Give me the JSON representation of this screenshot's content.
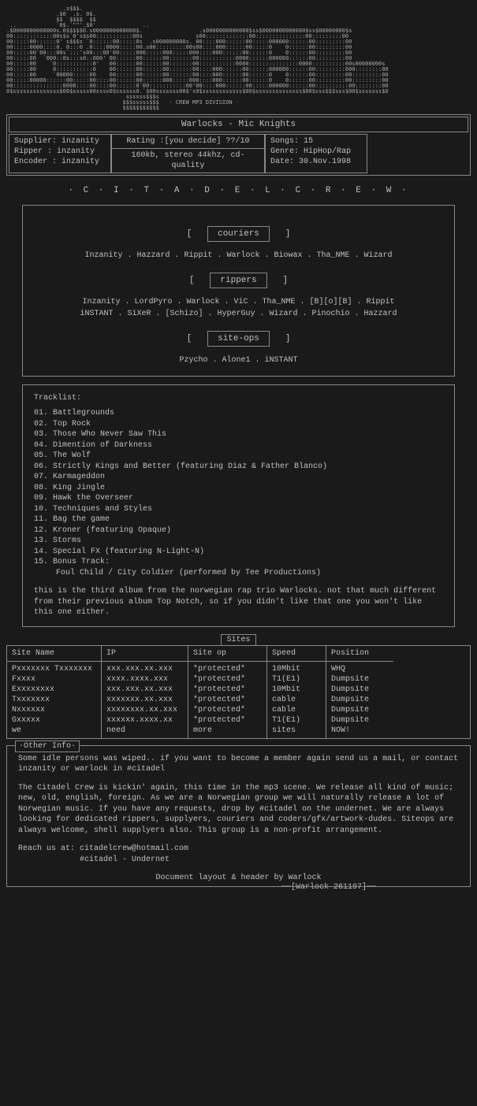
{
  "logo_ascii": "                 .s$$$.\n               .$0  .s. 0$.\n               $$  $$$$  $$\n ..            `0$.`\"\"'.$0'              ..\n.$0000000000000s.0$$$$$0.s0000000000000$.                 .s0000000000000$ss$0000000000000$ss$00000000$s\n00::::::::::::00s$s`0's$s00:::::::::::00s                s00:::::::::::::00:::::::::::::::00:::::::::00\n00:::::00::::::0' s$$$s `0::::::00:::::0s  .s000000000s. 00::::000::::::00:::::000000::::::00:::::::::00\n00:::::0000::::0. 0:::0 .0::::0000:::::00.s00:::::::::00s00::::000::::::00:::::0    0::::::00:::::::::00\n00:::::00`00:::00s`:::'s00:::00'00:::::000:::::000:::::000::::000::::::00::::::0    0::::::00:::::::::00\n00:::::00  `000::0s:::s0::000' 00::::::00::::::00:::::::00:::::::::::0000::::::000000::::::00:::::::::00\n00:::::00    `0:::::::::::0'   00::::::00::::::00:::::::00:::::::::::0000:::::::::::::::0000::::::::::00s00000000s\n00:::::00     0:::::::::::0    00::::::00::::::00:::::::00::::000::::::00::::::000000::::::00:::::::::000::::::::00\n00:::::00     `00000:::::00    00::::::00::::::00:::::::00::::000::::::00::::::0    0::::::00:::::::::00:::::::::00\n00:::::00000::::::00:::::00::::00::::::00::::::000:::::000::::000::::::00::::::0    0::::::00:::::::::00:::::::::00\n00:::::::::::::::0000::::00::::00::::::0`00:::::::::::00'00::::000::::::00:::::000000::::::00::::::::::00::::::::00\n0$ssssssssssssss$00$sssss00ssss0$ssssss0.`$00sssssss00$'s0$ssssssssssss$00$ssssssssssssss$00$sss$$$sss$00$sssssss$0\n                                    ssssss$$$s\n                                   $$$sssss$$$   · CREW MP3 DIVISION ·\n                                   $$$$$$$$$$$",
  "division": "· CREW MP3 DIVISION ·",
  "release": {
    "title": "Warlocks - Mic Knights",
    "supplier_label": "Supplier:",
    "supplier": "inzanity",
    "ripper_label": "Ripper  :",
    "ripper": "inzanity",
    "encoder_label": "Encoder :",
    "encoder": "inzanity",
    "rating_label": "Rating  :",
    "rating": "[you decide] ??/10",
    "quality": "160kb, stereo 44khz, cd-quality",
    "songs_label": "Songs:",
    "songs": "15",
    "genre_label": "Genre:",
    "genre": "HipHop/Rap",
    "date_label": "Date:",
    "date": "30.Nov.1998"
  },
  "crew_header": "· C · I · T · A · D · E · L · C · R · E · W ·",
  "roles": {
    "couriers_label": "couriers",
    "couriers": "Inzanity . Hazzard . Rippit . Warlock . Biowax . Tha_NME . Wizard",
    "rippers_label": "rippers",
    "rippers_line1": "Inzanity . LordPyro . Warlock . ViC . Tha_NME . [B][o][B] . Rippit",
    "rippers_line2": "iNSTANT . SiXeR . [Schizo] . HyperGuy . Wizard . Pinochio . Hazzard",
    "siteops_label": "site-ops",
    "siteops": "Pzycho . Alone1 . iNSTANT"
  },
  "tracklist": {
    "title": "Tracklist:",
    "tracks": [
      "01. Battlegrounds",
      "02. Top Rock",
      "03. Those Who Never Saw This",
      "04. Dimention of Darkness",
      "05. The Wolf",
      "06. Strictly Kings and Better (featuring Diaz & Father Blanco)",
      "07. Karmageddon",
      "08. King Jingle",
      "09. Hawk the Overseer",
      "10. Techniques and Styles",
      "11. Bag the game",
      "12. Kroner (featuring Opaque)",
      "13. Storms",
      "14. Special FX (featuring N-Light-N)",
      "15. Bonus Track:"
    ],
    "bonus_detail": "Foul Child / City Coldier (performed by Tee Productions)",
    "note": "this is the third album from the norwegian rap trio Warlocks. not that much different from their previous album Top Notch, so if you didn't like that one you won't like this one either."
  },
  "sites": {
    "header": "Sites",
    "col_headers": [
      "Site Name",
      "IP",
      "Site op",
      "Speed",
      "Position"
    ],
    "rows": [
      {
        "name": "Pxxxxxxx Txxxxxxx",
        "ip": "xxx.xxx.xx.xxx",
        "op": "*protected*",
        "speed": "10Mbit",
        "pos": "WHQ"
      },
      {
        "name": "Fxxxx",
        "ip": "xxxx.xxxx.xxx",
        "op": "*protected*",
        "speed": "T1(E1)",
        "pos": "Dumpsite"
      },
      {
        "name": "Exxxxxxxx",
        "ip": "xxx.xxx.xx.xxx",
        "op": "*protected*",
        "speed": "10Mbit",
        "pos": "Dumpsite"
      },
      {
        "name": "Txxxxxxx",
        "ip": "xxxxxxx.xx.xxx",
        "op": "*protected*",
        "speed": "cable",
        "pos": "Dumpsite"
      },
      {
        "name": "Nxxxxxx",
        "ip": "xxxxxxxx.xx.xxx",
        "op": "*protected*",
        "speed": "cable",
        "pos": "Dumpsite"
      },
      {
        "name": "Gxxxxx",
        "ip": "xxxxxx.xxxx.xx",
        "op": "*protected*",
        "speed": "T1(E1)",
        "pos": "Dumpsite"
      },
      {
        "name": "we",
        "ip": "need",
        "op": "more",
        "speed": "sites",
        "pos": "NOW!"
      }
    ]
  },
  "other": {
    "label": "·Other Info·",
    "p1": "Some idle persons was wiped.. if you want to become a member again send us a mail, or contact inzanity or warlock in #citadel",
    "p2": "The Citadel Crew is kickin' again, this time in the mp3 scene. We release all kind of music; new, old, english, foreign. As we are a Norwegian group we will naturally release a lot of Norwegian music. If you have any requests, drop by #citadel on the undernet. We are always looking for dedicated rippers, supplyers, couriers and coders/gfx/artwork-dudes. Siteops are always welcome, shell supplyers also. This group is a non-profit arrangement.",
    "reach1": "Reach us at: citadelcrew@hotmail.com",
    "reach2": "             #citadel - Undernet",
    "credit": "Document layout & header by Warlock",
    "sig": "──[Warlock 261197]──"
  }
}
